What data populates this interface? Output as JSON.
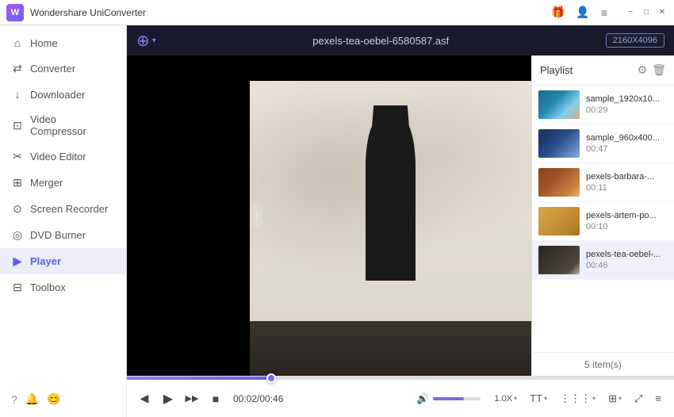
{
  "app": {
    "title": "Wondershare UniConverter",
    "logo_letter": "W"
  },
  "titlebar": {
    "controls": {
      "minimize": "−",
      "maximize": "□",
      "close": "✕"
    },
    "icons": {
      "gift": "🎁",
      "user": "👤",
      "menu": "≡"
    }
  },
  "sidebar": {
    "items": [
      {
        "id": "home",
        "label": "Home",
        "icon": "⌂"
      },
      {
        "id": "converter",
        "label": "Converter",
        "icon": "↔"
      },
      {
        "id": "downloader",
        "label": "Downloader",
        "icon": "↓"
      },
      {
        "id": "video-compressor",
        "label": "Video Compressor",
        "icon": "⊡"
      },
      {
        "id": "video-editor",
        "label": "Video Editor",
        "icon": "✂"
      },
      {
        "id": "merger",
        "label": "Merger",
        "icon": "⊞"
      },
      {
        "id": "screen-recorder",
        "label": "Screen Recorder",
        "icon": "⊙"
      },
      {
        "id": "dvd-burner",
        "label": "DVD Burner",
        "icon": "◎"
      },
      {
        "id": "player",
        "label": "Player",
        "icon": "▶",
        "active": true
      },
      {
        "id": "toolbox",
        "label": "Toolbox",
        "icon": "⊟"
      }
    ],
    "bottom_icons": [
      "?",
      "🔔",
      "😊"
    ]
  },
  "player": {
    "add_button_icon": "⊕",
    "filename": "pexels-tea-oebel-6580587.asf",
    "resolution": "2160X4096",
    "collapse_arrow": "‹"
  },
  "playlist": {
    "title": "Playlist",
    "settings_icon": "⚙",
    "delete_icon": "🗑",
    "items": [
      {
        "id": 1,
        "name": "sample_1920x10...",
        "duration": "00:29",
        "thumb_class": "thumb-1"
      },
      {
        "id": 2,
        "name": "sample_960x400...",
        "duration": "00:47",
        "thumb_class": "thumb-2"
      },
      {
        "id": 3,
        "name": "pexels-barbara-...",
        "duration": "00:11",
        "thumb_class": "thumb-3"
      },
      {
        "id": 4,
        "name": "pexels-artem-po...",
        "duration": "00:10",
        "thumb_class": "thumb-4"
      },
      {
        "id": 5,
        "name": "pexels-tea-oebel-...",
        "duration": "00:46",
        "thumb_class": "thumb-5",
        "active": true
      }
    ],
    "footer": "5 item(s)"
  },
  "controls": {
    "rewind": "◀",
    "play": "▶",
    "forward": "▶▶",
    "stop": "■",
    "time_current": "00:02",
    "time_total": "00:46",
    "volume_icon": "🔊",
    "speed_label": "1.0X",
    "text_label": "TT",
    "audio_label": "|||",
    "crop_label": "⊞",
    "fullscreen_label": "⤢",
    "menu_label": "≡",
    "chevron": "▾"
  }
}
